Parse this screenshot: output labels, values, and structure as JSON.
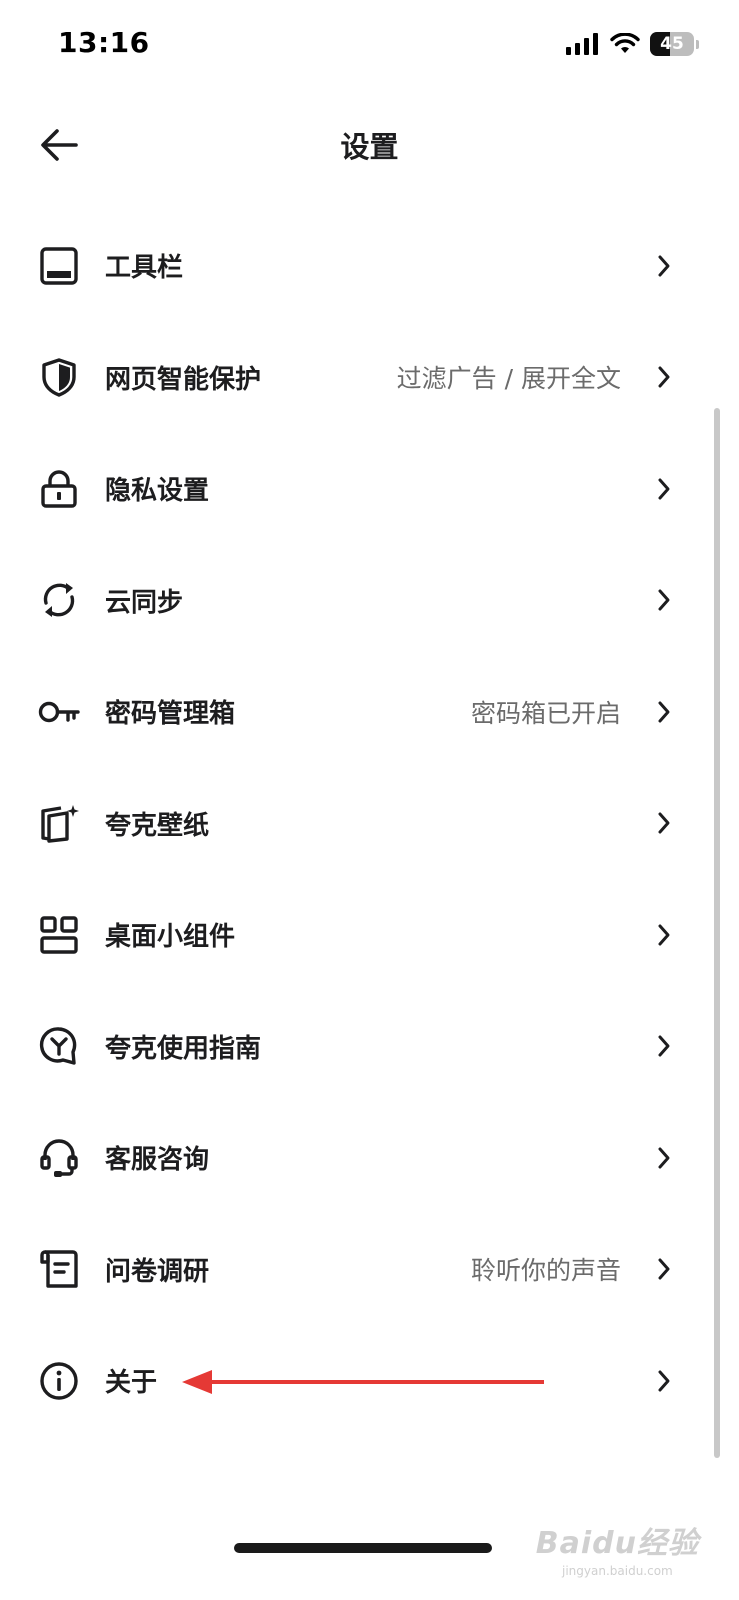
{
  "status_bar": {
    "time": "13:16",
    "battery_level": "45",
    "battery_fraction": 0.45
  },
  "header": {
    "title": "设置",
    "back_icon": "arrow-left-icon"
  },
  "settings": [
    {
      "label": "工具栏",
      "value": "",
      "icon": "toolbar-icon"
    },
    {
      "label": "网页智能保护",
      "value": "过滤广告 / 展开全文",
      "icon": "shield-icon"
    },
    {
      "label": "隐私设置",
      "value": "",
      "icon": "lock-icon"
    },
    {
      "label": "云同步",
      "value": "",
      "icon": "sync-icon"
    },
    {
      "label": "密码管理箱",
      "value": "密码箱已开启",
      "icon": "key-icon"
    },
    {
      "label": "夸克壁纸",
      "value": "",
      "icon": "wallpaper-icon"
    },
    {
      "label": "桌面小组件",
      "value": "",
      "icon": "widget-icon"
    },
    {
      "label": "夸克使用指南",
      "value": "",
      "icon": "guide-icon"
    },
    {
      "label": "客服咨询",
      "value": "",
      "icon": "headset-icon"
    },
    {
      "label": "问卷调研",
      "value": "聆听你的声音",
      "icon": "survey-icon"
    },
    {
      "label": "关于",
      "value": "",
      "icon": "info-icon"
    }
  ],
  "watermark": {
    "main": "Baidu经验",
    "sub": "jingyan.baidu.com"
  },
  "colors": {
    "text_primary": "#1d1d1f",
    "text_secondary": "#6b6b6b",
    "annotation_arrow": "#e53935"
  }
}
